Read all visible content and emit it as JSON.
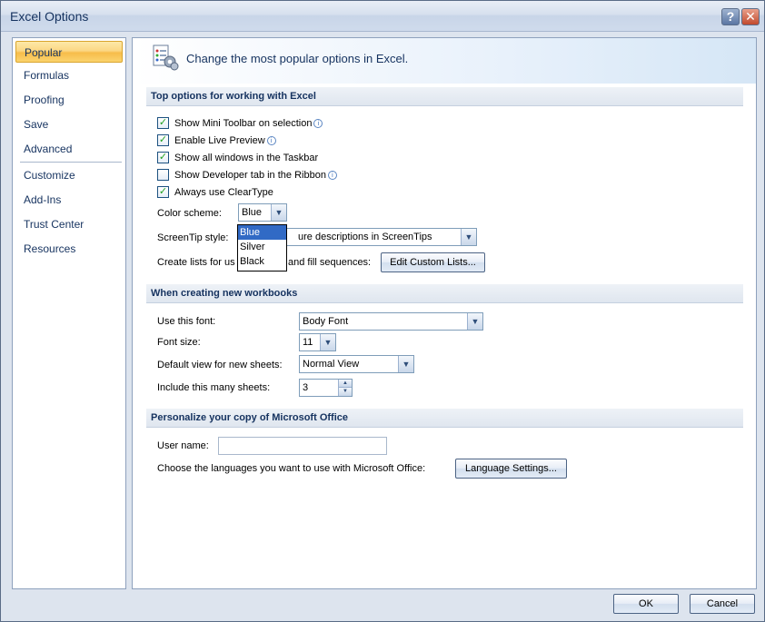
{
  "window": {
    "title": "Excel Options",
    "help_glyph": "?",
    "close_glyph": "✕"
  },
  "nav": {
    "items": [
      {
        "label": "Popular"
      },
      {
        "label": "Formulas"
      },
      {
        "label": "Proofing"
      },
      {
        "label": "Save"
      },
      {
        "label": "Advanced"
      },
      {
        "label": "Customize"
      },
      {
        "label": "Add-Ins"
      },
      {
        "label": "Trust Center"
      },
      {
        "label": "Resources"
      }
    ],
    "selected": "Popular"
  },
  "banner": {
    "text": "Change the most popular options in Excel.",
    "icon": "options-settings-icon"
  },
  "top_options": {
    "header": "Top options for working with Excel",
    "checks": [
      {
        "label": "Show Mini Toolbar on selection",
        "checked": true,
        "info": true
      },
      {
        "label": "Enable Live Preview",
        "checked": true,
        "info": true
      },
      {
        "label": "Show all windows in the Taskbar",
        "checked": true,
        "info": false
      },
      {
        "label": "Show Developer tab in the Ribbon",
        "checked": false,
        "info": true
      },
      {
        "label": "Always use ClearType",
        "checked": true,
        "info": false
      }
    ],
    "color_scheme": {
      "label": "Color scheme:",
      "value": "Blue",
      "options": [
        "Blue",
        "Silver",
        "Black"
      ],
      "highlighted": "Blue"
    },
    "screentip": {
      "label": "ScreenTip style:",
      "value_visible": "ure descriptions in ScreenTips"
    },
    "custom_lists": {
      "label_left": "Create lists for us",
      "label_right": "and fill sequences:",
      "button": "Edit Custom Lists..."
    }
  },
  "new_workbooks": {
    "header": "When creating new workbooks",
    "font": {
      "label": "Use this font:",
      "value": "Body Font"
    },
    "font_size": {
      "label": "Font size:",
      "value": "11"
    },
    "default_view": {
      "label": "Default view for new sheets:",
      "value": "Normal View"
    },
    "sheets": {
      "label": "Include this many sheets:",
      "value": "3"
    }
  },
  "personalize": {
    "header": "Personalize your copy of Microsoft Office",
    "user_name": {
      "label": "User name:",
      "value": ""
    },
    "languages": {
      "label": "Choose the languages you want to use with Microsoft Office:",
      "button": "Language Settings..."
    }
  },
  "footer": {
    "ok": "OK",
    "cancel": "Cancel"
  },
  "info_glyph": "i",
  "check_glyph": "✓",
  "arrow_glyph": "▼",
  "colors": {
    "accent_blue": "#15325f",
    "selection": "#316ac5",
    "nav_selected": "#fbd784"
  }
}
